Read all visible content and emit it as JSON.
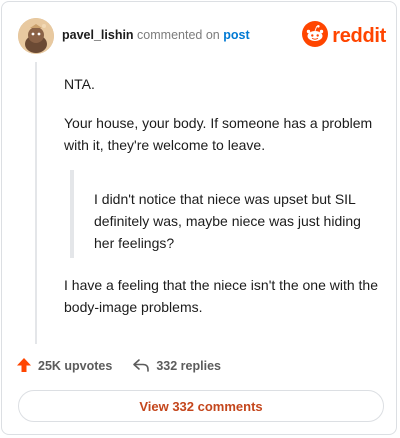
{
  "header": {
    "username": "pavel_lishin",
    "commented_on": "commented on",
    "post_link": "post",
    "brand": "reddit"
  },
  "comment": {
    "p1": "NTA.",
    "p2": "Your house, your body. If someone has a problem with it, they're welcome to leave.",
    "quote": "I didn't notice that niece was upset but SIL definitely was, maybe niece was just hiding her feelings?",
    "p3": "I have a feeling that the niece isn't the one with the body-image problems."
  },
  "actions": {
    "upvotes": "25K upvotes",
    "replies": "332 replies"
  },
  "footer": {
    "view_button": "View 332 comments"
  },
  "colors": {
    "brand": "#ff4500",
    "link": "#0079d3",
    "view_button_text": "#c4461c"
  },
  "icons": [
    "avatar",
    "reddit-logo-icon",
    "upvote-arrow-icon",
    "reply-icon"
  ]
}
